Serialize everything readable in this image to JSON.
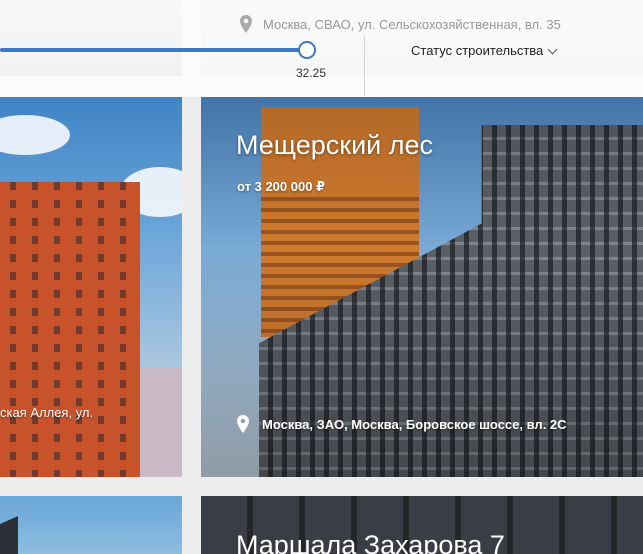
{
  "filters": {
    "slider_value": "32.25",
    "status_dropdown_label": "Статус строительства"
  },
  "cards": {
    "top_right": {
      "address": "Москва, СВАО, ул. Сельскохозяйственная, вл. 35"
    },
    "middle_left": {
      "address": "ская Аллея, ул."
    },
    "middle_right": {
      "title": "Мещерский лес",
      "price": "от 3 200 000 ₽",
      "address": "Москва, ЗАО, Москва, Боровское шоссе, вл. 2С"
    },
    "bottom_right": {
      "title": "Маршала Захарова 7"
    }
  },
  "colors": {
    "accent": "#3c78c8",
    "page_background": "#ececec",
    "card_text": "#ffffff"
  },
  "icons": {
    "location": "location-pin-icon",
    "dropdown": "chevron-down-icon"
  }
}
